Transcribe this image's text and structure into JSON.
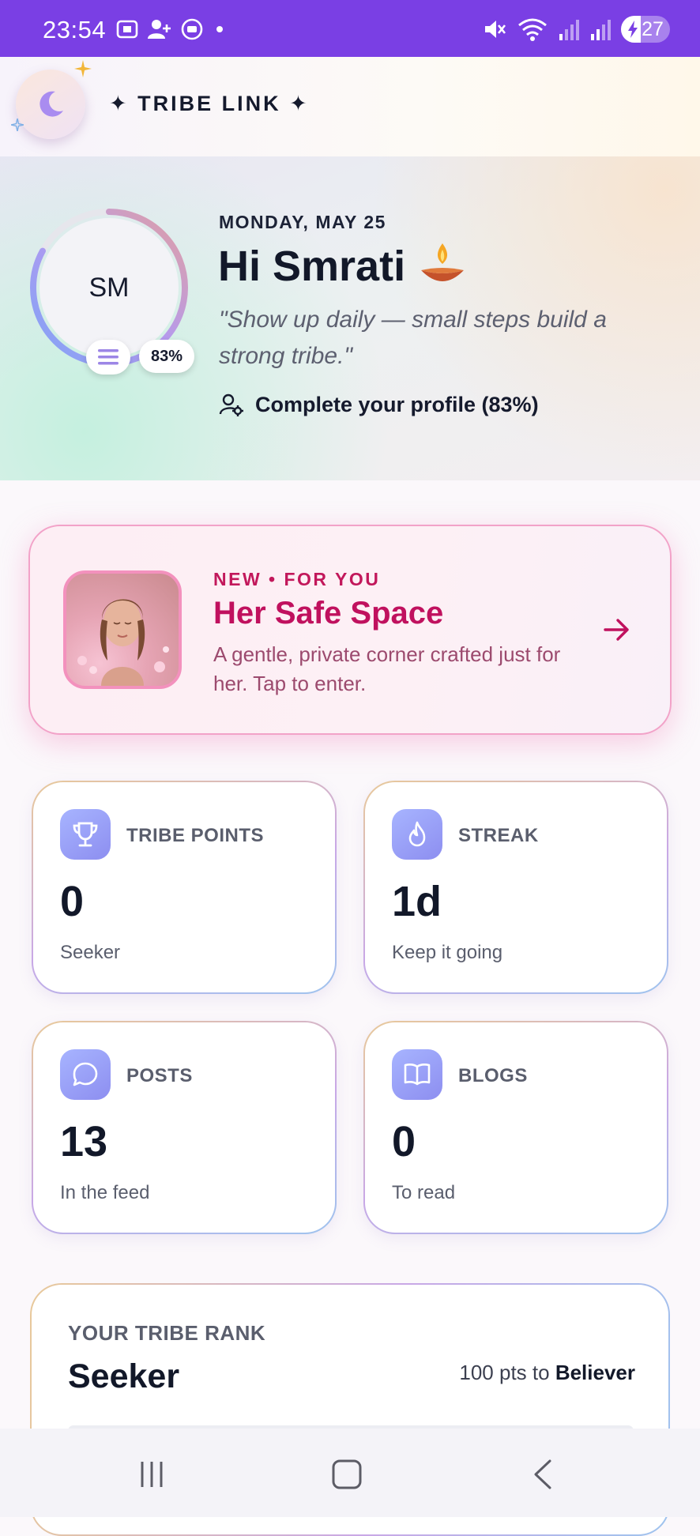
{
  "status_bar": {
    "time": "23:54",
    "battery_level": "27",
    "icons": [
      "screenshot-icon",
      "add-person-icon",
      "record-icon",
      "dot-icon",
      "mute-icon",
      "wifi-icon",
      "signal-icon",
      "signal-icon",
      "battery-charging-icon"
    ]
  },
  "header": {
    "brand": "✦ TRIBE LINK ✦",
    "theme_toggle_icon": "moon-icon"
  },
  "hero": {
    "date": "MONDAY, MAY 25",
    "greeting": "Hi Smrati",
    "greeting_icon": "diya-lamp-icon",
    "avatar_initials": "SM",
    "profile_percent_badge": "83%",
    "profile_completion": 0.83,
    "quote": "\"Show up daily — small steps build a strong tribe.\"",
    "profile_link": "Complete your profile (83%)"
  },
  "safe_space": {
    "eyebrow": "NEW • FOR YOU",
    "title": "Her Safe Space",
    "description": "A gentle, private corner crafted just for her. Tap to enter.",
    "accent": "#c0115e"
  },
  "stats": [
    {
      "icon": "trophy-icon",
      "label": "TRIBE POINTS",
      "value": "0",
      "sub": "Seeker"
    },
    {
      "icon": "flame-icon",
      "label": "STREAK",
      "value": "1d",
      "sub": "Keep it going"
    },
    {
      "icon": "chat-bubble-icon",
      "label": "POSTS",
      "value": "13",
      "sub": "In the feed"
    },
    {
      "icon": "open-book-icon",
      "label": "BLOGS",
      "value": "0",
      "sub": "To read"
    }
  ],
  "rank": {
    "label": "YOUR TRIBE RANK",
    "value": "Seeker",
    "next_prefix": "100 pts to ",
    "next_rank": "Believer"
  },
  "colors": {
    "status_bar": "#7a3fe4",
    "text_primary": "#121829",
    "safe_accent": "#c0115e",
    "icon_gradient_start": "#a7b4ff",
    "icon_gradient_end": "#8d8ef0"
  }
}
